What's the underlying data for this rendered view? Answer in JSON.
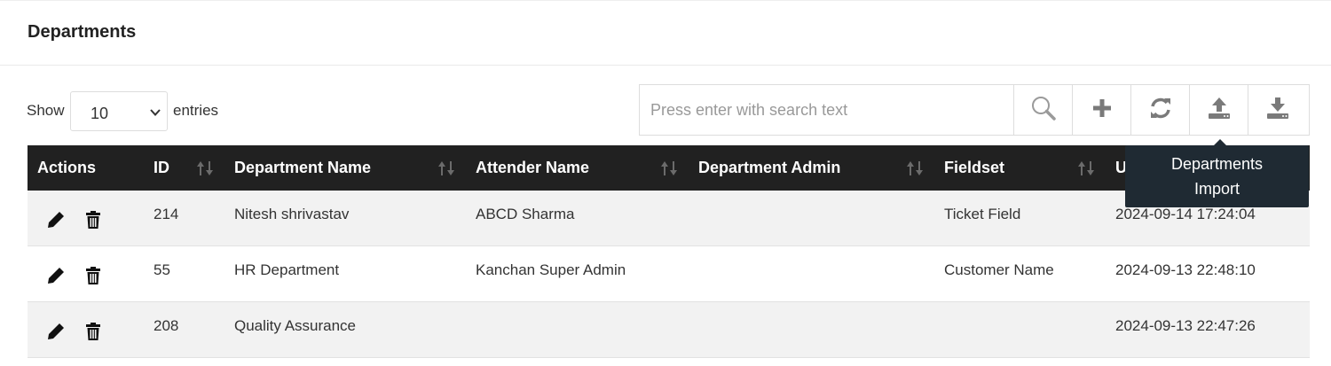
{
  "panel": {
    "title": "Departments"
  },
  "length_menu": {
    "show_label": "Show",
    "selected": "10",
    "entries_label": "entries"
  },
  "search": {
    "placeholder": "Press enter with search text"
  },
  "toolbar": {
    "buttons": [
      {
        "icon": "search-icon"
      },
      {
        "icon": "plus-icon"
      },
      {
        "icon": "refresh-icon"
      },
      {
        "icon": "upload-icon"
      },
      {
        "icon": "download-icon"
      }
    ]
  },
  "tooltip": {
    "line1": "Departments",
    "line2": "Import"
  },
  "table": {
    "headers": {
      "actions": "Actions",
      "id": "ID",
      "department_name": "Department Name",
      "attender_name": "Attender Name",
      "department_admin": "Department Admin",
      "fieldset": "Fieldset",
      "updated": "U"
    },
    "rows": [
      {
        "id": "214",
        "department_name": "Nitesh shrivastav",
        "attender_name": "ABCD Sharma",
        "department_admin": "",
        "fieldset": "Ticket Field",
        "updated": "2024-09-14 17:24:04"
      },
      {
        "id": "55",
        "department_name": "HR Department",
        "attender_name": "Kanchan Super Admin",
        "department_admin": "",
        "fieldset": "Customer Name",
        "updated": "2024-09-13 22:48:10"
      },
      {
        "id": "208",
        "department_name": "Quality Assurance",
        "attender_name": "",
        "department_admin": "",
        "fieldset": "",
        "updated": "2024-09-13 22:47:26"
      }
    ]
  },
  "colors": {
    "header_bg": "#212121",
    "stripe_bg": "#f2f2f2",
    "tooltip_bg": "#1f2a33",
    "sort_icon": "#6b6b6b"
  }
}
